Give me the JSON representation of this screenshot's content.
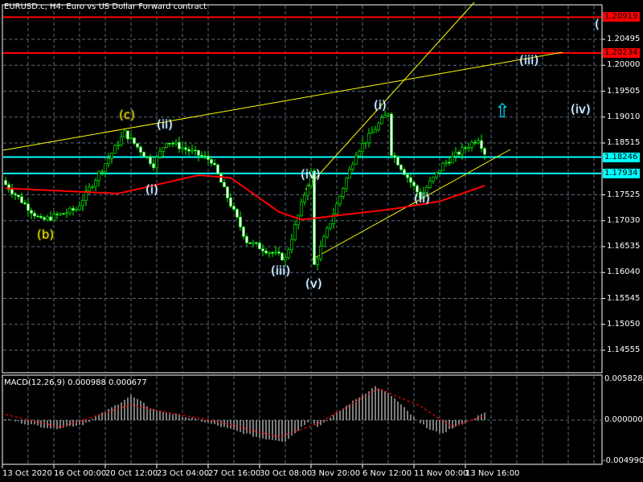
{
  "window": {
    "title": "EURUSD.c, H4:  Euro vs US Dollar Forward contract"
  },
  "price_axis": {
    "labels": [
      "1.20495",
      "1.20000",
      "1.19505",
      "1.19010",
      "1.18515",
      "1.17525",
      "1.17030",
      "1.16535",
      "1.16040",
      "1.15545",
      "1.15050",
      "1.14555"
    ]
  },
  "price_tags": [
    {
      "value": "1.20919",
      "color": "#ff0000"
    },
    {
      "value": "1.20234",
      "color": "#ff0000"
    },
    {
      "value": "1.18246",
      "color": "#00ffff"
    },
    {
      "value": "1.17934",
      "color": "#00ffff"
    }
  ],
  "macd": {
    "label": "MACD(12,26,9) 0.000988 0.000677",
    "axis": [
      "0.005828",
      "0.000000",
      "-0.004990"
    ]
  },
  "time_axis": [
    "13 Oct 2020",
    "16 Oct 00:00",
    "20 Oct 12:00",
    "23 Oct 04:00",
    "27 Oct 16:00",
    "30 Oct 08:00",
    "3 Nov 20:00",
    "6 Nov 12:00",
    "11 Nov 00:00",
    "13 Nov 16:00"
  ],
  "waves": {
    "b": "(b)",
    "c": "(c)",
    "i1": "(i)",
    "ii1": "(ii)",
    "iii1": "(iii)",
    "iv1": "(iv)",
    "v1": "(v)",
    "i2": "(i)",
    "ii2": "(ii)",
    "iii2": "(iii)",
    "iv2": "(iv)",
    "partial": "("
  },
  "arrow": "up-arrow-icon",
  "chart_data": {
    "type": "candlestick",
    "symbol": "EURUSD.c",
    "timeframe": "H4",
    "ylim": [
      1.142,
      1.212
    ],
    "close_pivots": [
      [
        0,
        1.1772
      ],
      [
        11,
        1.1703
      ],
      [
        22,
        1.1725
      ],
      [
        37,
        1.1871
      ],
      [
        46,
        1.181
      ],
      [
        50,
        1.1856
      ],
      [
        64,
        1.1818
      ],
      [
        75,
        1.1664
      ],
      [
        87,
        1.163
      ],
      [
        95,
        1.1795
      ],
      [
        96,
        1.1618
      ],
      [
        109,
        1.1833
      ],
      [
        119,
        1.191
      ],
      [
        120,
        1.1833
      ],
      [
        129,
        1.1749
      ],
      [
        136,
        1.181
      ],
      [
        147,
        1.1861
      ],
      [
        149,
        1.1833
      ]
    ],
    "ma_pivots": [
      [
        0,
        1.1765
      ],
      [
        35,
        1.1755
      ],
      [
        60,
        1.179
      ],
      [
        70,
        1.1785
      ],
      [
        85,
        1.172
      ],
      [
        92,
        1.1705
      ],
      [
        120,
        1.1725
      ],
      [
        135,
        1.174
      ],
      [
        149,
        1.177
      ]
    ],
    "horizontal_levels": [
      1.20919,
      1.20234,
      1.18246,
      1.17934
    ],
    "macd": {
      "ylim": [
        -0.00499,
        0.005828
      ],
      "hist_pivots": [
        [
          0,
          0.0002
        ],
        [
          6,
          -0.0005
        ],
        [
          15,
          -0.0012
        ],
        [
          24,
          -0.0006
        ],
        [
          31,
          0.0012
        ],
        [
          39,
          0.0035
        ],
        [
          46,
          0.0015
        ],
        [
          56,
          0.0005
        ],
        [
          66,
          -0.0008
        ],
        [
          79,
          -0.0025
        ],
        [
          87,
          -0.003
        ],
        [
          95,
          0.0002
        ],
        [
          97,
          -0.001
        ],
        [
          109,
          0.003
        ],
        [
          115,
          0.0048
        ],
        [
          120,
          0.0035
        ],
        [
          129,
          -0.0005
        ],
        [
          135,
          -0.002
        ],
        [
          142,
          -0.0005
        ],
        [
          149,
          0.001
        ]
      ],
      "signal_pivots": [
        [
          0,
          0.0008
        ],
        [
          17,
          -0.001
        ],
        [
          39,
          0.0022
        ],
        [
          49,
          0.0012
        ],
        [
          66,
          -0.0002
        ],
        [
          85,
          -0.0024
        ],
        [
          97,
          -0.0005
        ],
        [
          116,
          0.0045
        ],
        [
          129,
          0.002
        ],
        [
          139,
          -0.001
        ],
        [
          149,
          0.0007
        ]
      ]
    }
  }
}
